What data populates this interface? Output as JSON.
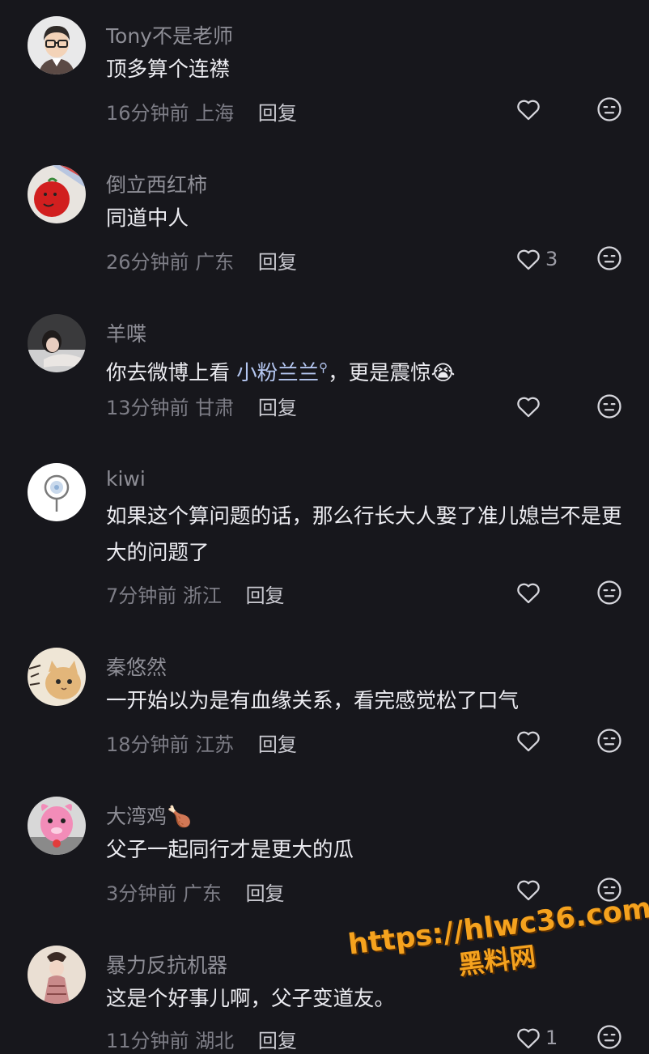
{
  "comments": [
    {
      "username": "Tony不是老师",
      "emoji": "",
      "content": "顶多算个连襟",
      "mention": "",
      "content_after": "",
      "time": "16分钟前",
      "location": "上海",
      "reply": "回复",
      "likes": ""
    },
    {
      "username": "倒立西红柿",
      "emoji": "",
      "content": "同道中人",
      "mention": "",
      "content_after": "",
      "time": "26分钟前",
      "location": "广东",
      "reply": "回复",
      "likes": "3"
    },
    {
      "username": "羊喋",
      "emoji": "",
      "content": "你去微博上看 ",
      "mention": "小粉兰兰",
      "content_after": "，更是震惊😭",
      "time": "13分钟前",
      "location": "甘肃",
      "reply": "回复",
      "likes": ""
    },
    {
      "username": "kiwi",
      "emoji": "",
      "content": "如果这个算问题的话，那么行长大人娶了准儿媳岂不是更大的问题了",
      "mention": "",
      "content_after": "",
      "time": "7分钟前",
      "location": "浙江",
      "reply": "回复",
      "likes": ""
    },
    {
      "username": "秦悠然",
      "emoji": "",
      "content": "一开始以为是有血缘关系，看完感觉松了口气",
      "mention": "",
      "content_after": "",
      "time": "18分钟前",
      "location": "江苏",
      "reply": "回复",
      "likes": ""
    },
    {
      "username": "大湾鸡",
      "emoji": "🍗",
      "content": "父子一起同行才是更大的瓜",
      "mention": "",
      "content_after": "",
      "time": "3分钟前",
      "location": "广东",
      "reply": "回复",
      "likes": ""
    },
    {
      "username": "暴力反抗机器",
      "emoji": "",
      "content": "这是个好事儿啊，父子变道友。",
      "mention": "",
      "content_after": "",
      "time": "11分钟前",
      "location": "湖北",
      "reply": "回复",
      "likes": "1"
    }
  ],
  "watermark": {
    "url": "https://hlwc36.com",
    "name": "黑料网"
  },
  "colors": {
    "background": "#17171c",
    "username": "#8e8e96",
    "content": "#ececf1",
    "mention": "#b4c6f0",
    "meta": "#7d7d86",
    "watermark": "#f5a21e"
  },
  "icons": {
    "like": "heart-outline-icon",
    "dislike": "neutral-face-icon"
  }
}
